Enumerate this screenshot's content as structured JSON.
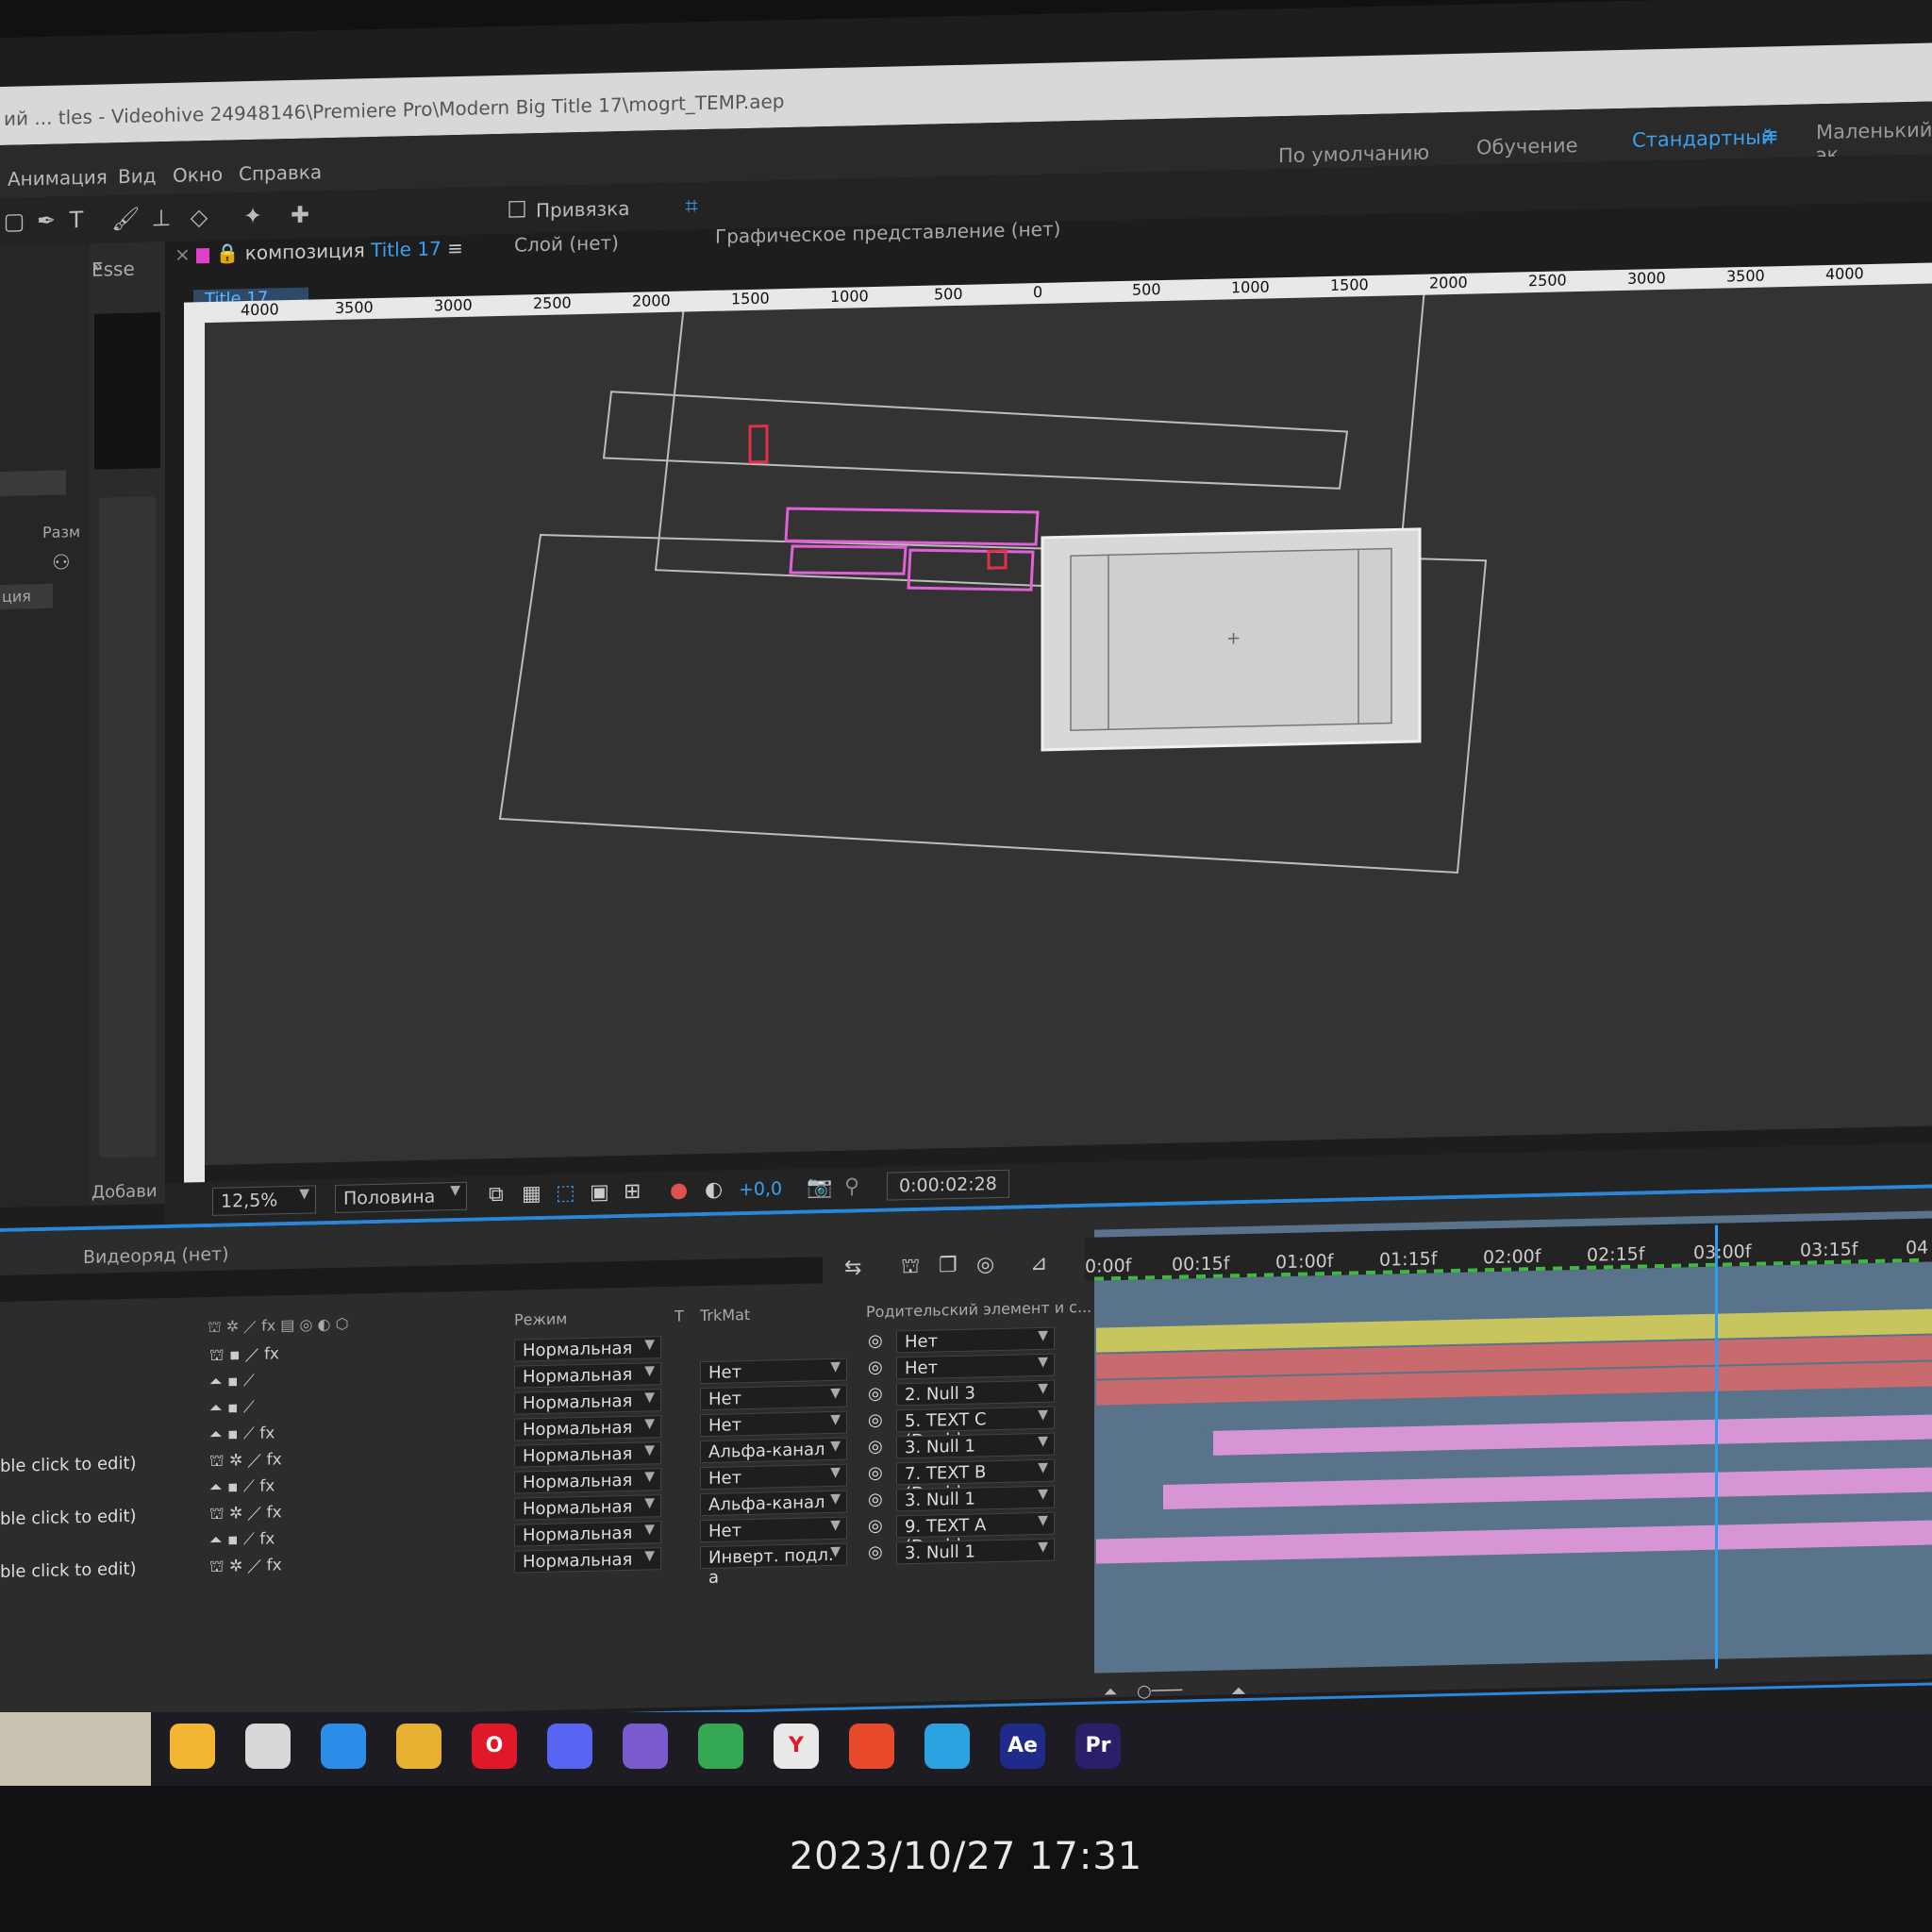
{
  "window": {
    "title": "ий ... tles - Videohive 24948146\\Premiere Pro\\Modern Big Title 17\\mogrt_TEMP.aep"
  },
  "menu": [
    "Анимация",
    "Вид",
    "Окно",
    "Справка"
  ],
  "workspaces": [
    {
      "label": "По умолчанию",
      "active": false
    },
    {
      "label": "Обучение",
      "active": false
    },
    {
      "label": "Стандартный",
      "active": true
    },
    {
      "label": "Маленький эк",
      "active": false
    }
  ],
  "toolbar": {
    "snap_label": "Привязка"
  },
  "panels": {
    "effects_tab": "Esse",
    "composition_prefix": "композиция",
    "composition_name": "Title 17",
    "layer_tab": "Слой (нет)",
    "graph_tab": "Графическое представление (нет)",
    "comp_subtab": "Title 17",
    "left_labels": [
      "Разм",
      "ция"
    ],
    "add_label": "Добави"
  },
  "rulers": {
    "horizontal": [
      "4000",
      "3500",
      "3000",
      "2500",
      "2000",
      "1500",
      "1000",
      "500",
      "0",
      "500",
      "1000",
      "1500",
      "2000",
      "2500",
      "3000",
      "3500",
      "4000"
    ]
  },
  "viewer_bar": {
    "zoom": "12,5%",
    "resolution": "Половина",
    "exposure": "+0,0",
    "timecode": "0:00:02:28"
  },
  "timeline": {
    "header": "Видеоряд (нет)",
    "columns": {
      "mode": "Режим",
      "t": "T",
      "trkmat": "TrkMat",
      "parent": "Родительский элемент и с..."
    },
    "ruler": [
      "0:00f",
      "00:15f",
      "01:00f",
      "01:15f",
      "02:00f",
      "02:15f",
      "03:00f",
      "03:15f",
      "04"
    ],
    "layers": [
      {
        "name": "",
        "mode": "Нормальная",
        "trkmat": "",
        "parent": "Нет",
        "bar_color": "#c8c45e",
        "bar_start": 0.0
      },
      {
        "name": "",
        "mode": "Нормальная",
        "trkmat": "Нет",
        "parent": "Нет",
        "bar_color": "#c86a6e",
        "bar_start": 0.0
      },
      {
        "name": "",
        "mode": "Нормальная",
        "trkmat": "Нет",
        "parent": "2. Null 3",
        "bar_color": "#c86a6e",
        "bar_start": 0.0
      },
      {
        "name": "",
        "mode": "Нормальная",
        "trkmat": "Нет",
        "parent": "5. TEXT C (Doubl",
        "bar_color": "#58738a",
        "bar_start": 0.0
      },
      {
        "name": "ble click to edit)",
        "mode": "Нормальная",
        "trkmat": "Альфа-канал",
        "parent": "3. Null 1",
        "bar_color": "#d895d6",
        "bar_start": 0.14
      },
      {
        "name": "",
        "mode": "Нормальная",
        "trkmat": "Нет",
        "parent": "7. TEXT B (Doubl",
        "bar_color": "#58738a",
        "bar_start": 0.0
      },
      {
        "name": "ble click to edit)",
        "mode": "Нормальная",
        "trkmat": "Альфа-канал",
        "parent": "3. Null 1",
        "bar_color": "#d895d6",
        "bar_start": 0.08
      },
      {
        "name": "",
        "mode": "Нормальная",
        "trkmat": "Нет",
        "parent": "9. TEXT A (Doubl",
        "bar_color": "#58738a",
        "bar_start": 0.0
      },
      {
        "name": "ble click to edit)",
        "mode": "Нормальная",
        "trkmat": "Инверт. подл. а",
        "parent": "3. Null 1",
        "bar_color": "#d895d6",
        "bar_start": 0.0
      }
    ],
    "playhead_fraction": 0.74
  },
  "taskbar": {
    "apps": [
      {
        "name": "file-explorer",
        "label": "",
        "color": "#f2b632"
      },
      {
        "name": "store",
        "label": "",
        "color": "#d8d8d8"
      },
      {
        "name": "mail",
        "label": "",
        "color": "#2a8de8"
      },
      {
        "name": "chrome-canary",
        "label": "",
        "color": "#e8b030"
      },
      {
        "name": "opera",
        "label": "O",
        "color": "#e0182a"
      },
      {
        "name": "discord",
        "label": "",
        "color": "#5865f2"
      },
      {
        "name": "viber",
        "label": "",
        "color": "#7b5ccf"
      },
      {
        "name": "chrome",
        "label": "",
        "color": "#34a853"
      },
      {
        "name": "yandex",
        "label": "Y",
        "color": "#e8e8e8"
      },
      {
        "name": "star-app",
        "label": "",
        "color": "#e8492a"
      },
      {
        "name": "telegram",
        "label": "",
        "color": "#2aa3e0"
      },
      {
        "name": "after-effects",
        "label": "Ae",
        "color": "#1f2a8a"
      },
      {
        "name": "premiere",
        "label": "Pr",
        "color": "#2a1f6a"
      }
    ]
  },
  "photo_timestamp": "2023/10/27 17:31"
}
